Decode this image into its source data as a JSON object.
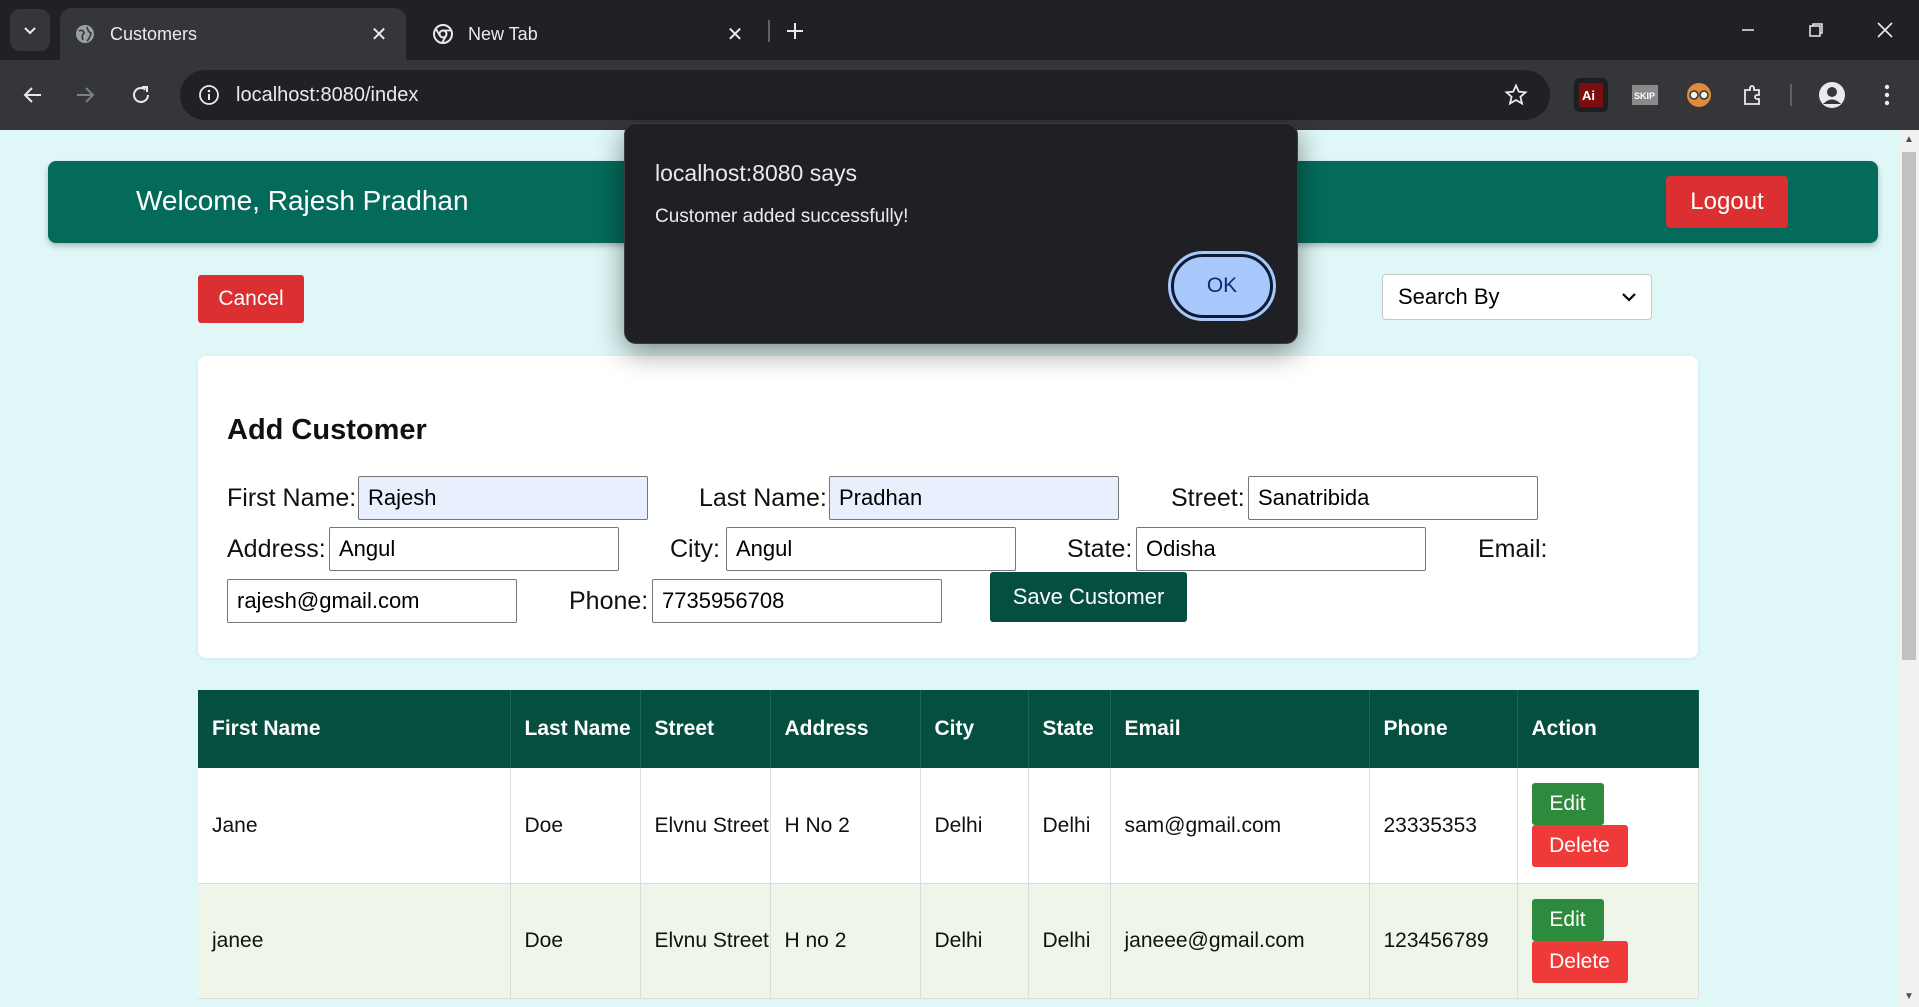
{
  "browser": {
    "tabs": [
      {
        "title": "Customers",
        "active": true,
        "icon": "globe-icon"
      },
      {
        "title": "New Tab",
        "active": false,
        "icon": "chrome-icon"
      }
    ],
    "url": "localhost:8080/index",
    "ext_ai_label": "Ai",
    "ext_skip_label": "SKIP"
  },
  "header": {
    "welcome": "Welcome, Rajesh Pradhan",
    "logout_label": "Logout"
  },
  "controls": {
    "cancel_label": "Cancel",
    "search_by": "Search By"
  },
  "form": {
    "title": "Add Customer",
    "first_name_label": "First Name:",
    "first_name_value": "Rajesh",
    "last_name_label": "Last Name:",
    "last_name_value": "Pradhan",
    "street_label": "Street:",
    "street_value": "Sanatribida",
    "address_label": "Address:",
    "address_value": "Angul",
    "city_label": "City:",
    "city_value": "Angul",
    "state_label": "State:",
    "state_value": "Odisha",
    "email_label": "Email:",
    "email_value": "rajesh@gmail.com",
    "phone_label": "Phone:",
    "phone_value": "7735956708",
    "save_label": "Save Customer"
  },
  "table": {
    "headers": [
      "First Name",
      "Last Name",
      "Street",
      "Address",
      "City",
      "State",
      "Email",
      "Phone",
      "Action"
    ],
    "rows": [
      {
        "first": "Jane",
        "last": "Doe",
        "street": "Elvnu Street",
        "address": "H No 2",
        "city": "Delhi",
        "state": "Delhi",
        "email": "sam@gmail.com",
        "phone": "23335353"
      },
      {
        "first": "janee",
        "last": "Doe",
        "street": "Elvnu Street",
        "address": "H no 2",
        "city": "Delhi",
        "state": "Delhi",
        "email": "janeee@gmail.com",
        "phone": "123456789"
      }
    ],
    "edit_label": "Edit",
    "delete_label": "Delete"
  },
  "dialog": {
    "title": "localhost:8080 says",
    "message": "Customer added successfully!",
    "ok_label": "OK"
  },
  "colors": {
    "header_bg": "#046b5b",
    "page_bg": "#e0f7f7",
    "table_header_bg": "#044f3f",
    "danger": "#dc2f32",
    "edit": "#2e8b3e"
  }
}
